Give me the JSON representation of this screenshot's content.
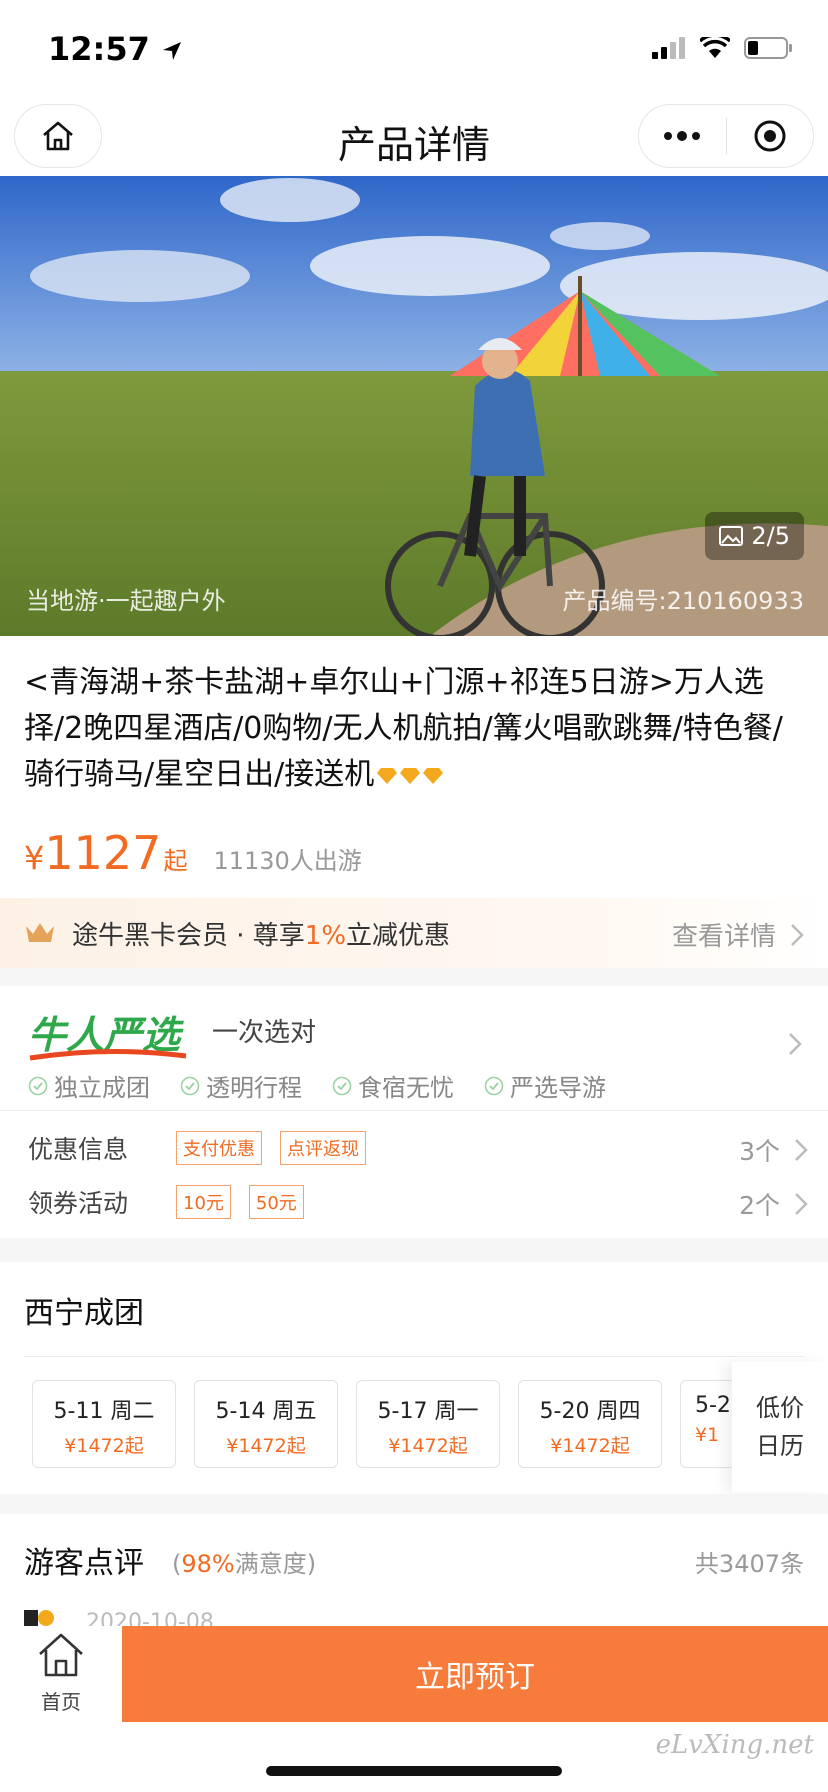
{
  "status_bar": {
    "time": "12:57"
  },
  "nav": {
    "title": "产品详情"
  },
  "hero": {
    "supplier": "当地游·一起趣户外",
    "product_code": "产品编号:210160933",
    "image_counter": "2/5"
  },
  "product": {
    "title": "<青海湖+茶卡盐湖+卓尔山+门源+祁连5日游>万人选择/2晚四星酒店/0购物/无人机航拍/篝火唱歌跳舞/特色餐/骑行骑马/星空日出/接送机",
    "price_symbol": "¥",
    "price": "1127",
    "price_suffix": "起",
    "travelers": "11130人出游"
  },
  "member": {
    "text_before": "途牛黑卡会员 · 尊享",
    "highlight": "1%",
    "text_after": "立减优惠",
    "link": "查看详情"
  },
  "niu_ren": {
    "logo": "牛人严选",
    "slogan": "一次选对",
    "features": [
      "独立成团",
      "透明行程",
      "食宿无忧",
      "严选导游"
    ]
  },
  "promotions": [
    {
      "label": "优惠信息",
      "tags": [
        "支付优惠",
        "点评返现"
      ],
      "count": "3个"
    },
    {
      "label": "领券活动",
      "tags": [
        "10元",
        "50元"
      ],
      "count": "2个"
    }
  ],
  "departures": {
    "title": "西宁成团",
    "dates": [
      {
        "date": "5-11 周二",
        "price": "¥1472起"
      },
      {
        "date": "5-14 周五",
        "price": "¥1472起"
      },
      {
        "date": "5-17 周一",
        "price": "¥1472起"
      },
      {
        "date": "5-20 周四",
        "price": "¥1472起"
      },
      {
        "date": "5-2",
        "price": "¥1"
      }
    ],
    "calendar_line1": "低价",
    "calendar_line2": "日历"
  },
  "reviews": {
    "title": "游客点评",
    "sat_open": "(",
    "sat_percent": "98%",
    "sat_text": "满意度)",
    "count": "共3407条",
    "first_date": "2020-10-08"
  },
  "bottom": {
    "home_label": "首页",
    "book_label": "立即预订",
    "watermark": "eLvXing.net"
  },
  "colors": {
    "accent": "#f26b22",
    "book_button": "#f77b3b",
    "niu_green": "#2ea84a"
  }
}
